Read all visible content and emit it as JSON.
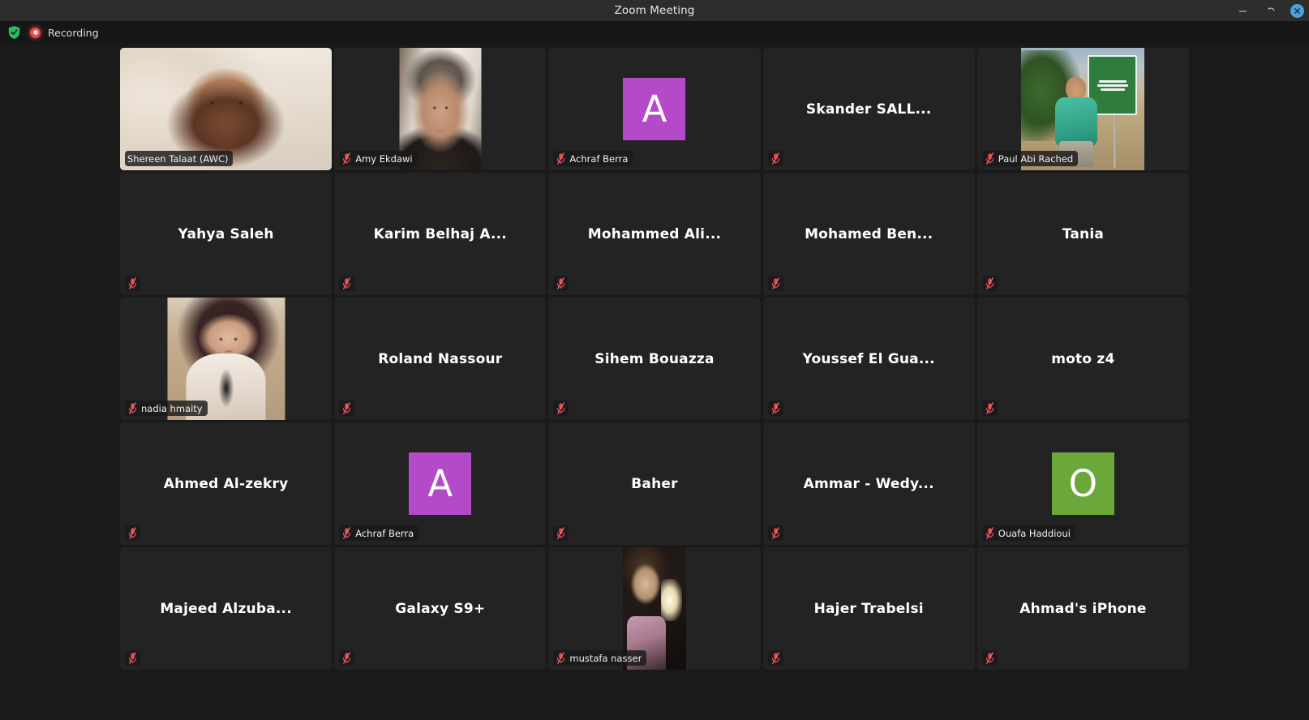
{
  "window": {
    "title": "Zoom Meeting",
    "controls": [
      {
        "name": "minimize-button",
        "glyph": "minimize"
      },
      {
        "name": "maximize-button",
        "glyph": "restore"
      },
      {
        "name": "close-button",
        "glyph": "close"
      }
    ]
  },
  "toolbar": {
    "shield_icon": "encryption-shield-icon",
    "recording_icon": "recording-dot-icon",
    "recording_label": "Recording"
  },
  "colors": {
    "window_titlebar": "#2d2d2d",
    "toolbar_bg": "#161616",
    "stage_bg": "#1a1a1a",
    "tile_bg": "#232323",
    "active_speaker_border": "#35d24a",
    "close_button": "#4aa3d8",
    "recording_red": "#e24c4c",
    "muted_mic_red": "#e84c50",
    "avatar_purple": "#b44ac7",
    "avatar_green": "#6aa939"
  },
  "grid": {
    "columns": 5,
    "rows": 5,
    "participants": [
      {
        "name": "Shereen Talaat (AWC)",
        "display": "pill",
        "media": "video",
        "video_class": "v-shereen",
        "video_mode": "fullbleed",
        "active_speaker": true,
        "muted": false
      },
      {
        "name": "Amy Ekdawi",
        "display": "pill",
        "media": "video",
        "video_class": "a-amy",
        "video_mode": "inset",
        "active_speaker": false,
        "muted": true
      },
      {
        "name": "Achraf Berra",
        "display": "pill",
        "media": "avatar",
        "avatar_letter": "A",
        "avatar_color": "#b44ac7",
        "active_speaker": false,
        "muted": true
      },
      {
        "name": "Skander SALL...",
        "display": "center",
        "media": "none",
        "active_speaker": false,
        "muted": true
      },
      {
        "name": "Paul Abi Rached",
        "display": "pill",
        "media": "video",
        "video_class": "a-paul",
        "video_mode": "inset",
        "active_speaker": false,
        "muted": true
      },
      {
        "name": "Yahya Saleh",
        "display": "center",
        "media": "none",
        "active_speaker": false,
        "muted": true
      },
      {
        "name": "Karim Belhaj A...",
        "display": "center",
        "media": "none",
        "active_speaker": false,
        "muted": true
      },
      {
        "name": "Mohammed Ali...",
        "display": "center",
        "media": "none",
        "active_speaker": false,
        "muted": true
      },
      {
        "name": "Mohamed Ben...",
        "display": "center",
        "media": "none",
        "active_speaker": false,
        "muted": true
      },
      {
        "name": "Tania",
        "display": "center",
        "media": "none",
        "active_speaker": false,
        "muted": true
      },
      {
        "name": "nadia hmaity",
        "display": "pill",
        "media": "video",
        "video_class": "a-nadia",
        "video_mode": "inset",
        "active_speaker": false,
        "muted": true
      },
      {
        "name": "Roland Nassour",
        "display": "center",
        "media": "none",
        "active_speaker": false,
        "muted": true
      },
      {
        "name": "Sihem Bouazza",
        "display": "center",
        "media": "none",
        "active_speaker": false,
        "muted": true
      },
      {
        "name": "Youssef El Gua...",
        "display": "center",
        "media": "none",
        "active_speaker": false,
        "muted": true
      },
      {
        "name": "moto z4",
        "display": "center",
        "media": "none",
        "active_speaker": false,
        "muted": true
      },
      {
        "name": "Ahmed Al-zekry",
        "display": "center",
        "media": "none",
        "active_speaker": false,
        "muted": true
      },
      {
        "name": "Achraf Berra",
        "display": "pill",
        "media": "avatar",
        "avatar_letter": "A",
        "avatar_color": "#b44ac7",
        "active_speaker": false,
        "muted": true
      },
      {
        "name": "Baher",
        "display": "center",
        "media": "none",
        "active_speaker": false,
        "muted": true
      },
      {
        "name": "Ammar - Wedy...",
        "display": "center",
        "media": "none",
        "active_speaker": false,
        "muted": true
      },
      {
        "name": "Ouafa Haddioui",
        "display": "pill",
        "media": "avatar",
        "avatar_letter": "O",
        "avatar_color": "#6aa939",
        "active_speaker": false,
        "muted": true
      },
      {
        "name": "Majeed Alzuba...",
        "display": "center",
        "media": "none",
        "active_speaker": false,
        "muted": true
      },
      {
        "name": "Galaxy S9+",
        "display": "center",
        "media": "none",
        "active_speaker": false,
        "muted": true
      },
      {
        "name": "mustafa nasser",
        "display": "pill",
        "media": "video",
        "video_class": "a-mustafa",
        "video_mode": "inset",
        "active_speaker": false,
        "muted": true
      },
      {
        "name": "Hajer Trabelsi",
        "display": "center",
        "media": "none",
        "active_speaker": false,
        "muted": true
      },
      {
        "name": "Ahmad's iPhone",
        "display": "center",
        "media": "none",
        "active_speaker": false,
        "muted": true
      }
    ]
  }
}
